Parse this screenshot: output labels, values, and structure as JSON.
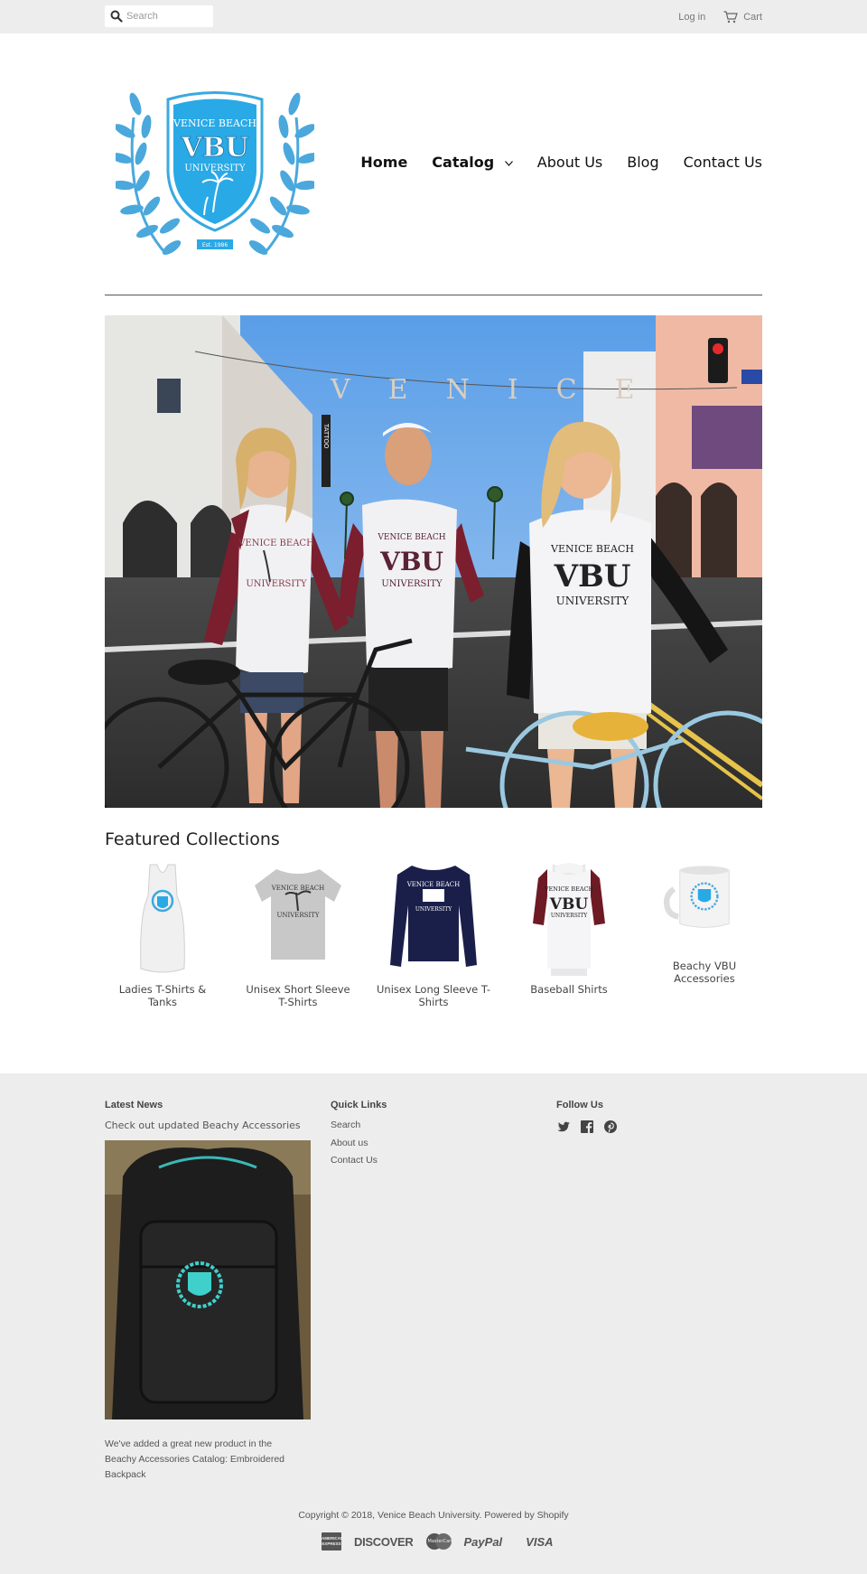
{
  "topbar": {
    "search_placeholder": "Search",
    "login_label": "Log in",
    "cart_label": "Cart"
  },
  "logo": {
    "line1": "VENICE BEACH",
    "line2": "VBU",
    "line3": "UNIVERSITY",
    "est": "Est. 1986",
    "color": "#3aa9e0"
  },
  "nav": {
    "home": "Home",
    "catalog": "Catalog",
    "about": "About Us",
    "blog": "Blog",
    "contact": "Contact Us"
  },
  "hero": {
    "sign_text": "VENICE",
    "shirt_text_1": "VENICE BEACH",
    "shirt_text_2": "VBU",
    "shirt_text_3": "UNIVERSITY",
    "tattoo_text": "TATTOO"
  },
  "featured": {
    "title": "Featured Collections",
    "items": [
      {
        "label": "Ladies T-Shirts & Tanks"
      },
      {
        "label": "Unisex Short Sleeve T-Shirts"
      },
      {
        "label": "Unisex Long Sleeve T-Shirts"
      },
      {
        "label": "Baseball Shirts"
      },
      {
        "label": "Beachy VBU Accessories"
      }
    ]
  },
  "footer": {
    "latest_news_title": "Latest News",
    "news_headline": "Check out updated Beachy Accessories",
    "news_text": "We've added a great new product in the Beachy Accessories Catalog: Embroidered Backpack",
    "quick_links_title": "Quick Links",
    "quick_links": [
      "Search",
      "About us",
      "Contact Us"
    ],
    "follow_title": "Follow Us",
    "social_icons": [
      "twitter-icon",
      "facebook-icon",
      "pinterest-icon"
    ],
    "copyright": "Copyright © 2018, Venice Beach University. Powered by Shopify",
    "payments": {
      "amex": "AMERICAN EXPRESS",
      "discover": "DISCOVER",
      "mastercard": "MasterCard",
      "paypal": "PayPal",
      "visa": "VISA"
    }
  }
}
